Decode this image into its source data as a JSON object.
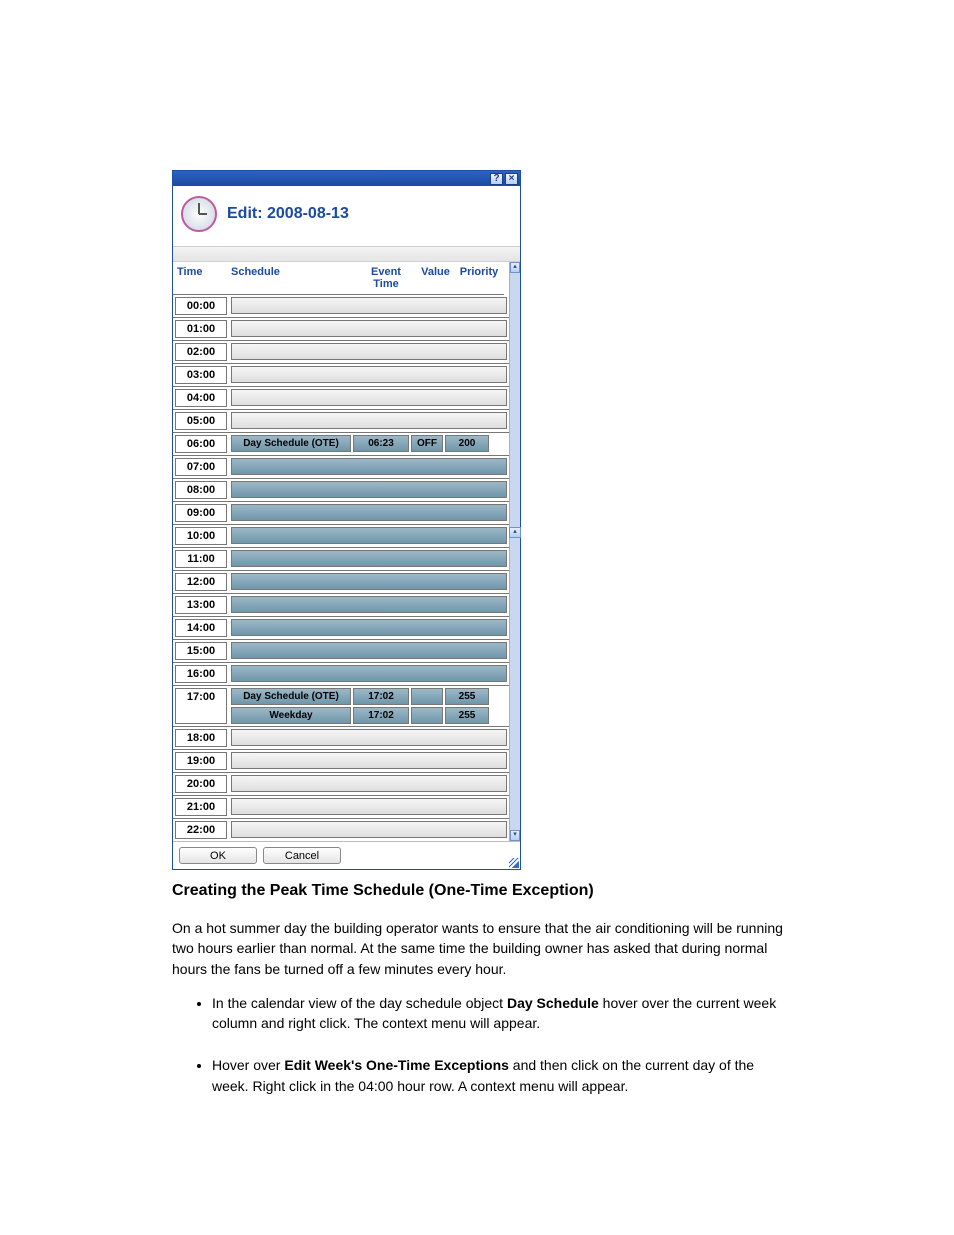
{
  "window": {
    "help_icon": "?",
    "close_icon": "×",
    "title_prefix": "Edit:",
    "title_date": "2008-08-13"
  },
  "grid": {
    "headers": {
      "time": "Time",
      "schedule": "Schedule",
      "event_time": "Event Time",
      "value": "Value",
      "priority": "Priority"
    },
    "rows": [
      {
        "time": "00:00",
        "filled": false,
        "entries": []
      },
      {
        "time": "01:00",
        "filled": false,
        "entries": []
      },
      {
        "time": "02:00",
        "filled": false,
        "entries": []
      },
      {
        "time": "03:00",
        "filled": false,
        "entries": []
      },
      {
        "time": "04:00",
        "filled": false,
        "entries": []
      },
      {
        "time": "05:00",
        "filled": false,
        "entries": []
      },
      {
        "time": "06:00",
        "filled": true,
        "entries": [
          {
            "schedule": "Day Schedule (OTE)",
            "event_time": "06:23",
            "value": "OFF",
            "priority": "200"
          }
        ]
      },
      {
        "time": "07:00",
        "filled": true,
        "entries": []
      },
      {
        "time": "08:00",
        "filled": true,
        "entries": []
      },
      {
        "time": "09:00",
        "filled": true,
        "entries": []
      },
      {
        "time": "10:00",
        "filled": true,
        "entries": []
      },
      {
        "time": "11:00",
        "filled": true,
        "entries": []
      },
      {
        "time": "12:00",
        "filled": true,
        "entries": []
      },
      {
        "time": "13:00",
        "filled": true,
        "entries": []
      },
      {
        "time": "14:00",
        "filled": true,
        "entries": []
      },
      {
        "time": "15:00",
        "filled": true,
        "entries": []
      },
      {
        "time": "16:00",
        "filled": true,
        "entries": []
      },
      {
        "time": "17:00",
        "filled": true,
        "entries": [
          {
            "schedule": "Day Schedule (OTE)",
            "event_time": "17:02",
            "value": "",
            "priority": "255"
          },
          {
            "schedule": "Weekday",
            "event_time": "17:02",
            "value": "",
            "priority": "255"
          }
        ]
      },
      {
        "time": "18:00",
        "filled": false,
        "entries": []
      },
      {
        "time": "19:00",
        "filled": false,
        "entries": []
      },
      {
        "time": "20:00",
        "filled": false,
        "entries": []
      },
      {
        "time": "21:00",
        "filled": false,
        "entries": []
      },
      {
        "time": "22:00",
        "filled": false,
        "entries": [],
        "partial": true
      }
    ]
  },
  "buttons": {
    "ok": "OK",
    "cancel": "Cancel"
  },
  "caption": "Creating the Peak Time Schedule (One-Time Exception)",
  "body": {
    "p1": "On a hot summer day the building operator wants to ensure that the air conditioning will be running two hours earlier than normal. At the same time the building owner has asked that during normal hours the fans be turned off a few minutes every hour.",
    "bullets": [
      {
        "intro_prefix": "In the calendar view of the day schedule object ",
        "intro_bold": "Day Schedule",
        "intro_suffix": " hover over the current week column and right click. The context menu will appear."
      },
      {
        "text_prefix": "Hover over ",
        "text_bold": "Edit Week's One-Time Exceptions",
        "text_suffix": " and then click on the current day of the week. Right click in the 04:00 hour row.  A context menu will appear."
      }
    ]
  }
}
